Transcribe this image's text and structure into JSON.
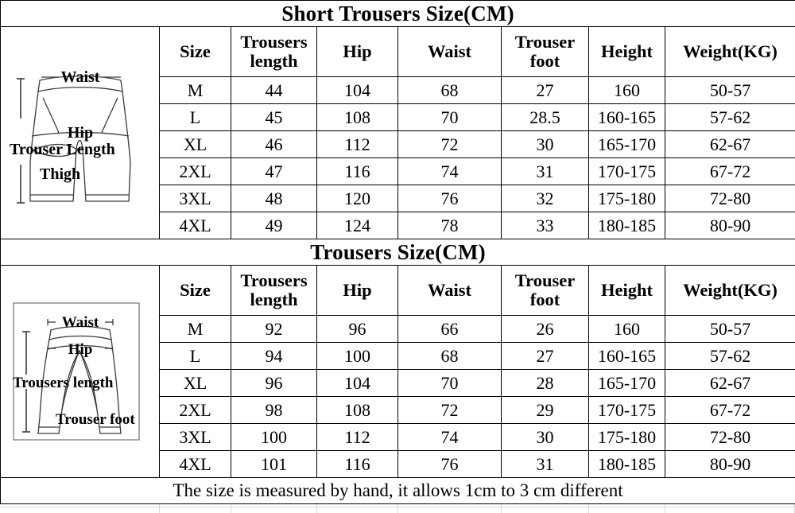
{
  "theme": {
    "header_bg": "#4aacc6",
    "border": "#000000",
    "page_bg": "#ffffff"
  },
  "tables": [
    {
      "id": "short-trousers",
      "title": "Short Trousers Size(CM)",
      "diagram": {
        "name": "shorts-measurement-diagram",
        "labels": [
          "Waist",
          "Hip",
          "Trouser Length",
          "Thigh"
        ]
      },
      "columns": [
        "Size",
        "Trousers length",
        "Hip",
        "Waist",
        "Trouser foot",
        "Height",
        "Weight(KG)"
      ],
      "rows": [
        [
          "M",
          "44",
          "104",
          "68",
          "27",
          "160",
          "50-57"
        ],
        [
          "L",
          "45",
          "108",
          "70",
          "28.5",
          "160-165",
          "57-62"
        ],
        [
          "XL",
          "46",
          "112",
          "72",
          "30",
          "165-170",
          "62-67"
        ],
        [
          "2XL",
          "47",
          "116",
          "74",
          "31",
          "170-175",
          "67-72"
        ],
        [
          "3XL",
          "48",
          "120",
          "76",
          "32",
          "175-180",
          "72-80"
        ],
        [
          "4XL",
          "49",
          "124",
          "78",
          "33",
          "180-185",
          "80-90"
        ]
      ]
    },
    {
      "id": "trousers",
      "title": "Trousers Size(CM)",
      "diagram": {
        "name": "trousers-measurement-diagram",
        "labels": [
          "Waist",
          "Hip",
          "Trousers length",
          "Trouser foot"
        ]
      },
      "columns": [
        "Size",
        "Trousers length",
        "Hip",
        "Waist",
        "Trouser foot",
        "Height",
        "Weight(KG)"
      ],
      "rows": [
        [
          "M",
          "92",
          "96",
          "66",
          "26",
          "160",
          "50-57"
        ],
        [
          "L",
          "94",
          "100",
          "68",
          "27",
          "160-165",
          "57-62"
        ],
        [
          "XL",
          "96",
          "104",
          "70",
          "28",
          "165-170",
          "62-67"
        ],
        [
          "2XL",
          "98",
          "108",
          "72",
          "29",
          "170-175",
          "67-72"
        ],
        [
          "3XL",
          "100",
          "112",
          "74",
          "30",
          "175-180",
          "72-80"
        ],
        [
          "4XL",
          "101",
          "116",
          "76",
          "31",
          "180-185",
          "80-90"
        ]
      ]
    }
  ],
  "footer_note": "The size is measured by hand, it allows 1cm to 3 cm different"
}
